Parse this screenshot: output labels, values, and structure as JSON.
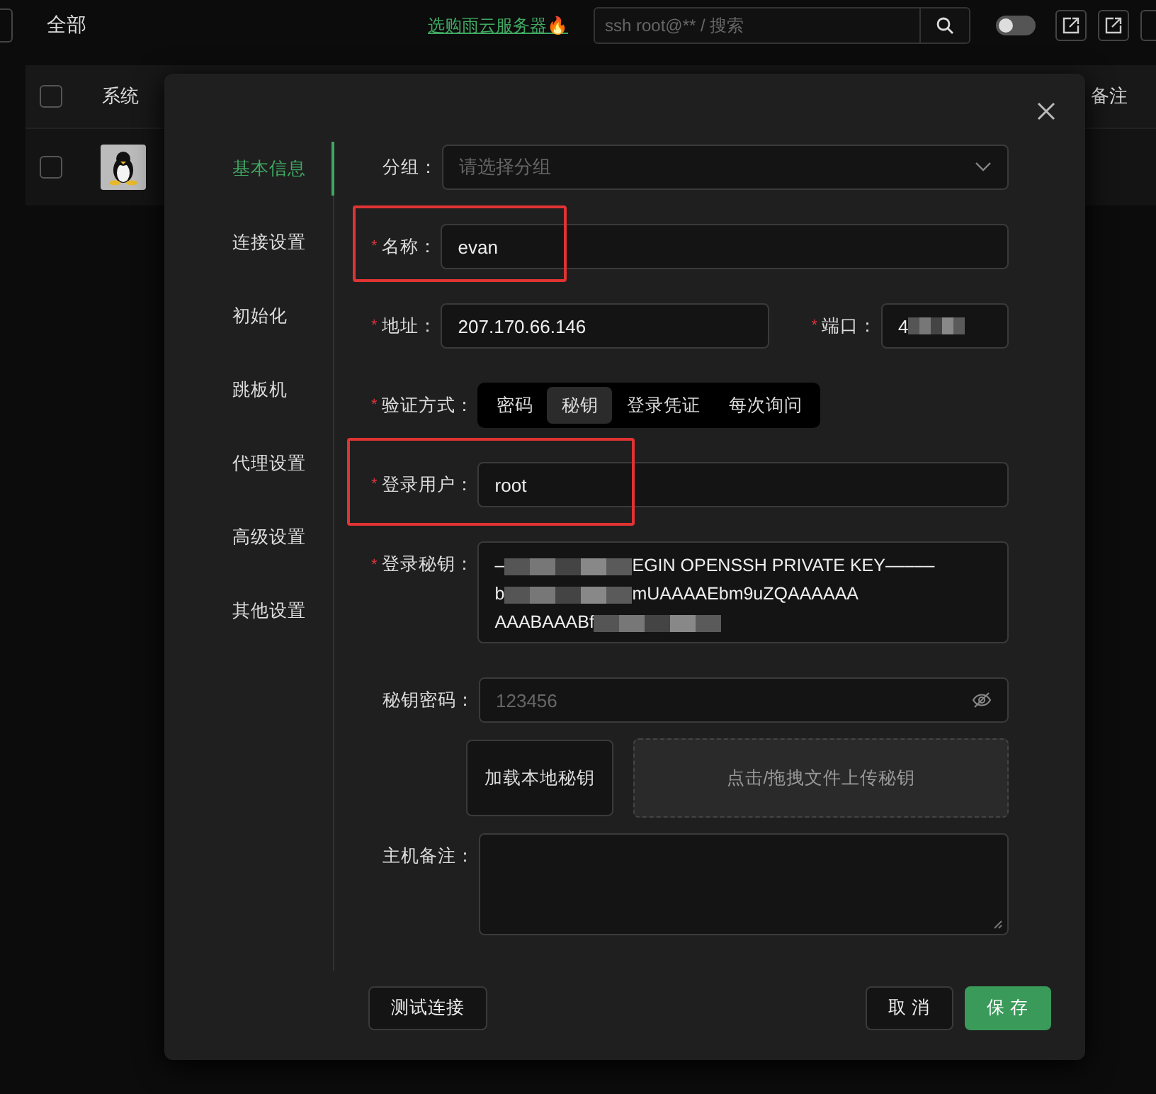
{
  "page": {
    "title": "全部",
    "promo_link": "选购雨云服务器🔥",
    "search": {
      "placeholder": "ssh root@** / 搜索"
    },
    "toggle": {
      "on": false
    }
  },
  "table": {
    "select_all": {
      "checked": false
    },
    "columns": [
      "系统",
      "备注"
    ],
    "rows": [
      {
        "checked": false
      }
    ]
  },
  "dialog": {
    "required_mark": "*",
    "nav": [
      {
        "label": "基本信息",
        "selected": true
      },
      {
        "label": "连接设置",
        "selected": false
      },
      {
        "label": "初始化",
        "selected": false
      },
      {
        "label": "跳板机",
        "selected": false
      },
      {
        "label": "代理设置",
        "selected": false
      },
      {
        "label": "高级设置",
        "selected": false
      },
      {
        "label": "其他设置",
        "selected": false
      }
    ],
    "fields": [
      {
        "kind": "select",
        "label": "分组：",
        "required": false,
        "placeholder": "请选择分组"
      },
      {
        "kind": "text",
        "label": "名称：",
        "required": true,
        "value": "evan",
        "highlighted": true
      },
      {
        "kind": "pair",
        "label": "地址：",
        "required": true,
        "value": "207.170.66.146",
        "second": {
          "label": "端口：",
          "required": true,
          "segments": [
            {
              "text": "4"
            },
            {
              "kind": "mosaic"
            }
          ]
        }
      },
      {
        "kind": "segmented",
        "label": "验证方式：",
        "required": true,
        "options": [
          {
            "label": "密码",
            "selected": false
          },
          {
            "label": "秘钥",
            "selected": true
          },
          {
            "label": "登录凭证",
            "selected": false
          },
          {
            "label": "每次询问",
            "selected": false
          }
        ]
      },
      {
        "kind": "text",
        "label": "登录用户：",
        "required": true,
        "value": "root",
        "highlighted": true
      },
      {
        "kind": "textarea",
        "label": "登录秘钥：",
        "required": true,
        "lines": [
          [
            {
              "text": "–"
            },
            {
              "kind": "mosaic"
            },
            {
              "text": "EGIN OPENSSH PRIVATE KEY–––––"
            }
          ],
          [
            {
              "text": "b"
            },
            {
              "kind": "mosaic"
            },
            {
              "text": "mUAAAAEbm9uZQAAAAAA"
            }
          ],
          [
            {
              "text": "AAABAAABf"
            },
            {
              "kind": "mosaic"
            }
          ]
        ]
      },
      {
        "kind": "password",
        "label": "秘钥密码：",
        "required": false,
        "placeholder": "123456"
      },
      {
        "kind": "upload",
        "button": "加载本地秘钥",
        "dropzone": "点击/拖拽文件上传秘钥"
      },
      {
        "kind": "textarea",
        "label": "主机备注：",
        "required": false
      }
    ],
    "buttons": [
      {
        "label": "测试连接",
        "kind": "default"
      },
      {
        "label": "取 消",
        "kind": "default"
      },
      {
        "label": "保 存",
        "kind": "primary"
      }
    ]
  }
}
